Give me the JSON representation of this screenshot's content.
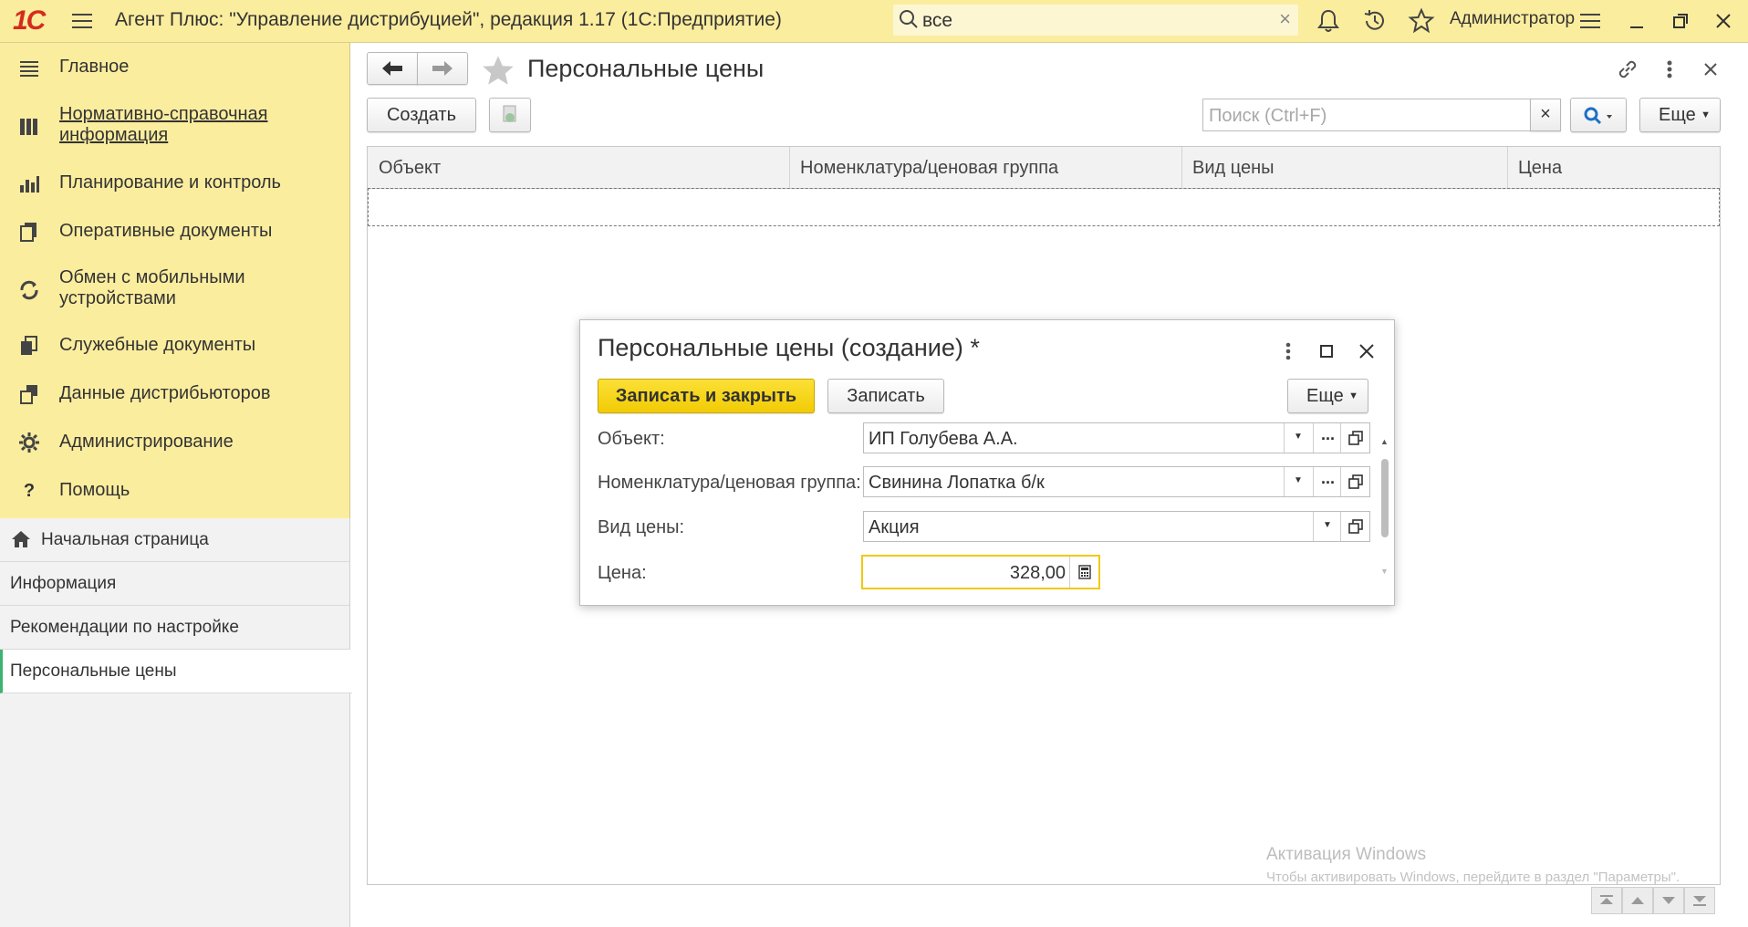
{
  "app": {
    "logo": "1С",
    "title": "Агент Плюс: \"Управление дистрибуцией\", редакция 1.17  (1С:Предприятие)",
    "search_value": "все",
    "user": "Администратор"
  },
  "sidebar": {
    "sections": [
      {
        "label": "Главное",
        "icon": "menu-lines-icon"
      },
      {
        "label": "Нормативно-справочная информация",
        "icon": "reference-books-icon",
        "link": true
      },
      {
        "label": "Планирование и контроль",
        "icon": "chart-bars-icon"
      },
      {
        "label": "Оперативные документы",
        "icon": "documents-icon"
      },
      {
        "label": "Обмен с мобильными устройствами",
        "icon": "sync-icon"
      },
      {
        "label": "Служебные документы",
        "icon": "service-documents-icon"
      },
      {
        "label": "Данные дистрибьюторов",
        "icon": "distributors-icon"
      },
      {
        "label": "Администрирование",
        "icon": "gear-icon"
      },
      {
        "label": "Помощь",
        "icon": "question-icon"
      }
    ],
    "open_windows": [
      {
        "label": "Начальная страница",
        "icon": "home-icon"
      },
      {
        "label": "Информация"
      },
      {
        "label": "Рекомендации по настройке"
      },
      {
        "label": "Персональные цены",
        "active": true
      }
    ]
  },
  "main": {
    "title": "Персональные цены",
    "create_label": "Создать",
    "search_placeholder": "Поиск (Ctrl+F)",
    "more_label": "Еще",
    "columns": [
      "Объект",
      "Номенклатура/ценовая группа",
      "Вид цены",
      "Цена"
    ]
  },
  "dialog": {
    "title": "Персональные цены (создание) *",
    "save_close_label": "Записать и закрыть",
    "save_label": "Записать",
    "more_label": "Еще",
    "fields": {
      "object": {
        "label": "Объект:",
        "value": "ИП Голубева А.А."
      },
      "nomenclature": {
        "label": "Номенклатура/ценовая группа:",
        "value": "Свинина Лопатка б/к"
      },
      "price_type": {
        "label": "Вид цены:",
        "value": "Акция"
      },
      "price": {
        "label": "Цена:",
        "value": "328,00"
      }
    }
  },
  "watermark": {
    "line1": "Активация Windows",
    "line2": "Чтобы активировать Windows, перейдите в раздел \"Параметры\"."
  },
  "colors": {
    "header_bg": "#fbed9e",
    "primary_button": "#f5d211",
    "active_marker": "#3cb371",
    "logo_red": "#d52b1e"
  }
}
